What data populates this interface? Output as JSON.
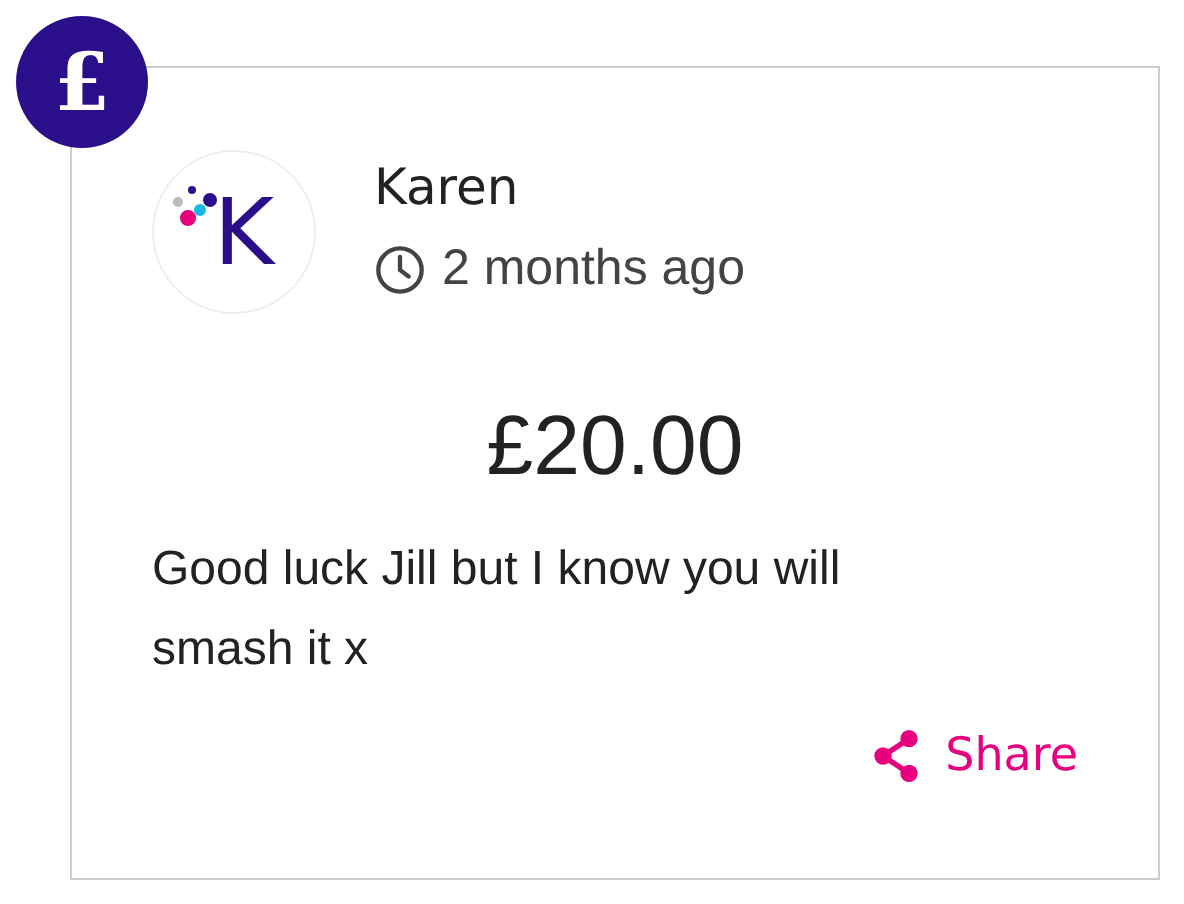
{
  "badge": "£",
  "donor": {
    "avatar_letter": "K",
    "name": "Karen",
    "time": "2 months ago"
  },
  "amount": "£20.00",
  "message": "Good luck Jill but I know you will smash it x",
  "share": "Share"
}
